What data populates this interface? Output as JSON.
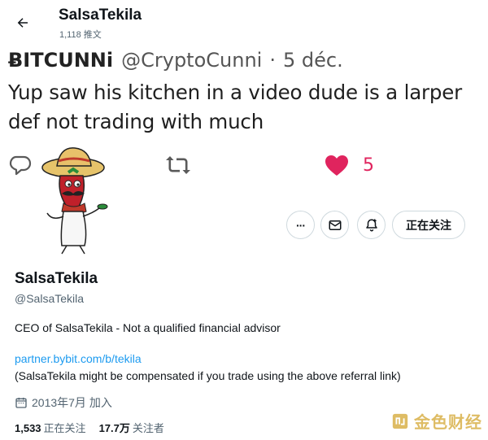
{
  "header": {
    "title": "SalsaTekila",
    "tweet_count": "1,118 推文"
  },
  "quoted_tweet": {
    "btc_symbol": "Ƀ",
    "name": "ITCUNNi",
    "handle": "@CryptoCunni",
    "separator": "·",
    "date": "5 déc.",
    "text": "Yup saw his kitchen in a video dude is a larper def not trading with much",
    "like_count": "5",
    "like_color": "#e0245e"
  },
  "profile_actions": {
    "more_label": "···",
    "follow_label": "正在关注"
  },
  "profile": {
    "display_name": "SalsaTekila",
    "handle": "@SalsaTekila",
    "bio": "CEO of SalsaTekila - Not a qualified financial advisor",
    "link": "partner.bybit.com/b/tekila",
    "disclaimer": "(SalsaTekila might be compensated if you trade using the above referral link)",
    "joined": "2013年7月 加入",
    "following_count": "1,533",
    "following_label": "正在关注",
    "followers_count": "17.7万",
    "followers_label": "关注者",
    "link_color": "#1d9bf0"
  },
  "watermark": {
    "text": "金色财经"
  },
  "icons": [
    "back-arrow-icon",
    "reply-icon",
    "retweet-icon",
    "heart-icon",
    "more-icon",
    "message-icon",
    "notification-plus-icon",
    "calendar-icon",
    "watermark-logo-icon"
  ]
}
